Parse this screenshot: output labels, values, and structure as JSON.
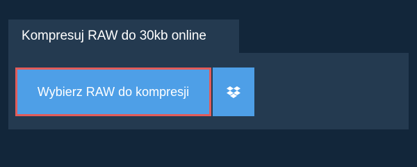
{
  "header": {
    "title": "Kompresuj RAW do 30kb online"
  },
  "upload": {
    "choose_label": "Wybierz RAW do kompresji",
    "dropbox_icon": "dropbox-icon"
  },
  "colors": {
    "background": "#12263a",
    "panel": "#243a50",
    "button": "#4e9fe7",
    "highlight_border": "#e25c5a",
    "text": "#ffffff"
  }
}
